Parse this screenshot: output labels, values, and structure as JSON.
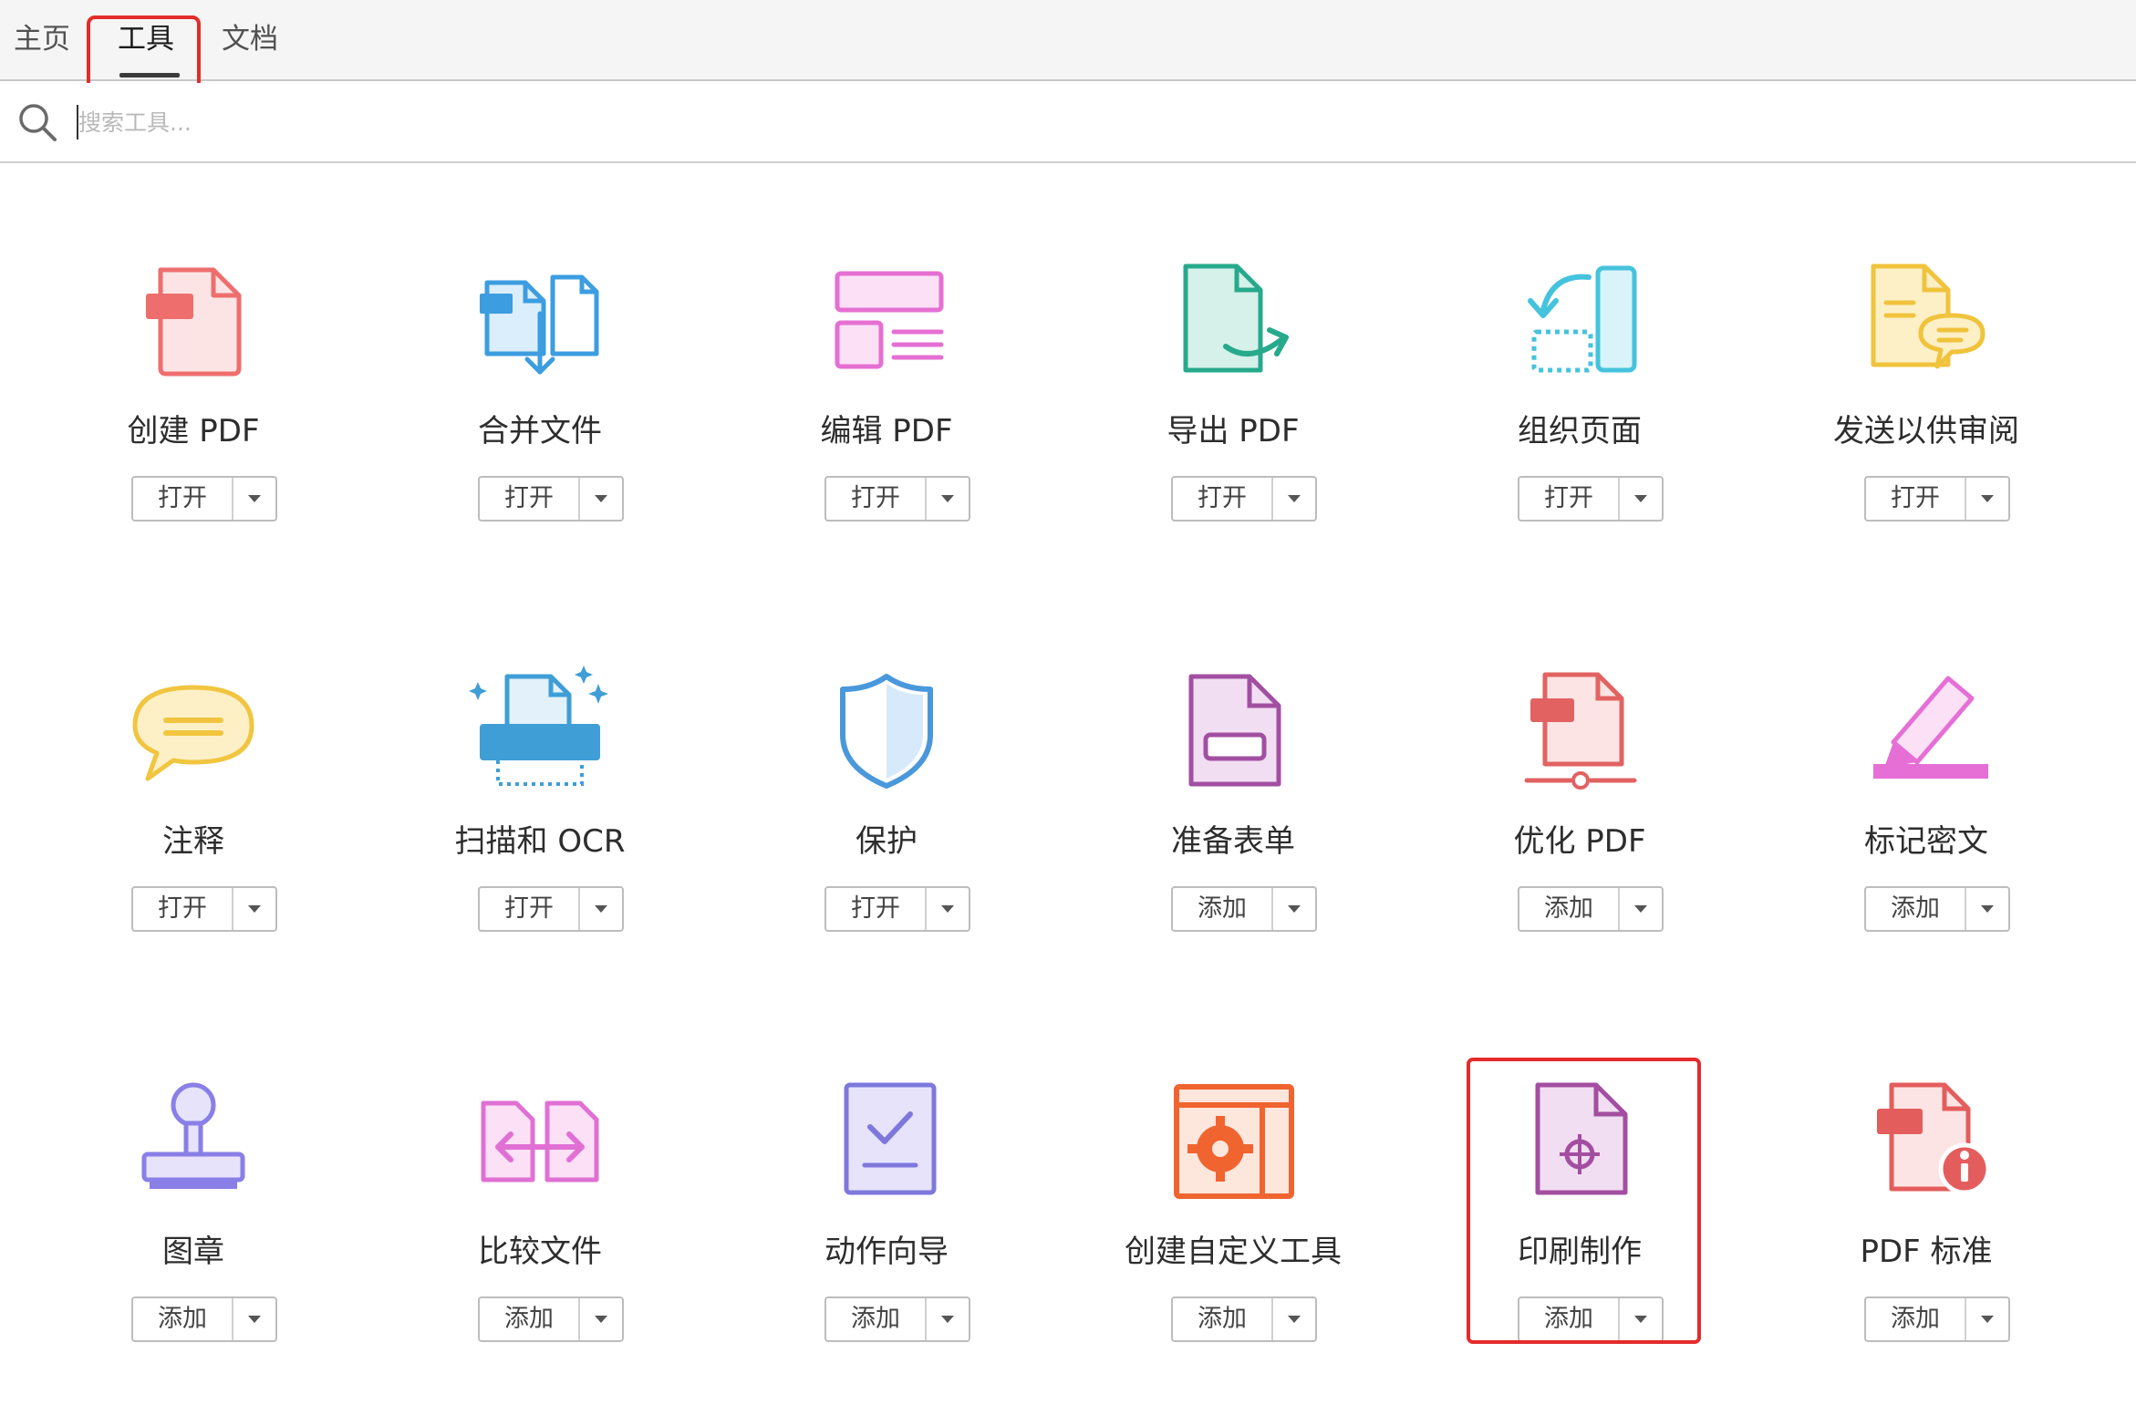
{
  "tabs": {
    "home": "主页",
    "tools": "工具",
    "documents": "文档"
  },
  "search": {
    "placeholder": "搜索工具..."
  },
  "tools": [
    {
      "name": "创建 PDF",
      "button": "打开",
      "icon": "create-pdf-icon",
      "color": "#ee6e6e"
    },
    {
      "name": "合并文件",
      "button": "打开",
      "icon": "combine-files-icon",
      "color": "#3c9de0"
    },
    {
      "name": "编辑 PDF",
      "button": "打开",
      "icon": "edit-pdf-icon",
      "color": "#e56fd3"
    },
    {
      "name": "导出 PDF",
      "button": "打开",
      "icon": "export-pdf-icon",
      "color": "#27a98c"
    },
    {
      "name": "组织页面",
      "button": "打开",
      "icon": "organize-pages-icon",
      "color": "#45c3dd"
    },
    {
      "name": "发送以供审阅",
      "button": "打开",
      "icon": "send-for-review-icon",
      "color": "#f0c33c"
    },
    {
      "name": "注释",
      "button": "打开",
      "icon": "comment-icon",
      "color": "#f1c53f"
    },
    {
      "name": "扫描和 OCR",
      "button": "打开",
      "icon": "scan-ocr-icon",
      "color": "#3f9ed6"
    },
    {
      "name": "保护",
      "button": "打开",
      "icon": "protect-icon",
      "color": "#4a98dc"
    },
    {
      "name": "准备表单",
      "button": "添加",
      "icon": "prepare-form-icon",
      "color": "#a24fa2"
    },
    {
      "name": "优化 PDF",
      "button": "添加",
      "icon": "optimize-pdf-icon",
      "color": "#e26262"
    },
    {
      "name": "标记密文",
      "button": "添加",
      "icon": "redact-icon",
      "color": "#e66fd6"
    },
    {
      "name": "图章",
      "button": "添加",
      "icon": "stamp-icon",
      "color": "#8a7fe6"
    },
    {
      "name": "比较文件",
      "button": "添加",
      "icon": "compare-files-icon",
      "color": "#e070d4"
    },
    {
      "name": "动作向导",
      "button": "添加",
      "icon": "action-wizard-icon",
      "color": "#7e77dc"
    },
    {
      "name": "创建自定义工具",
      "button": "添加",
      "icon": "custom-tool-icon",
      "color": "#f06430"
    },
    {
      "name": "印刷制作",
      "button": "添加",
      "icon": "print-production-icon",
      "color": "#a34ea0"
    },
    {
      "name": "PDF 标准",
      "button": "添加",
      "icon": "pdf-standards-icon",
      "color": "#e45d5d"
    }
  ]
}
